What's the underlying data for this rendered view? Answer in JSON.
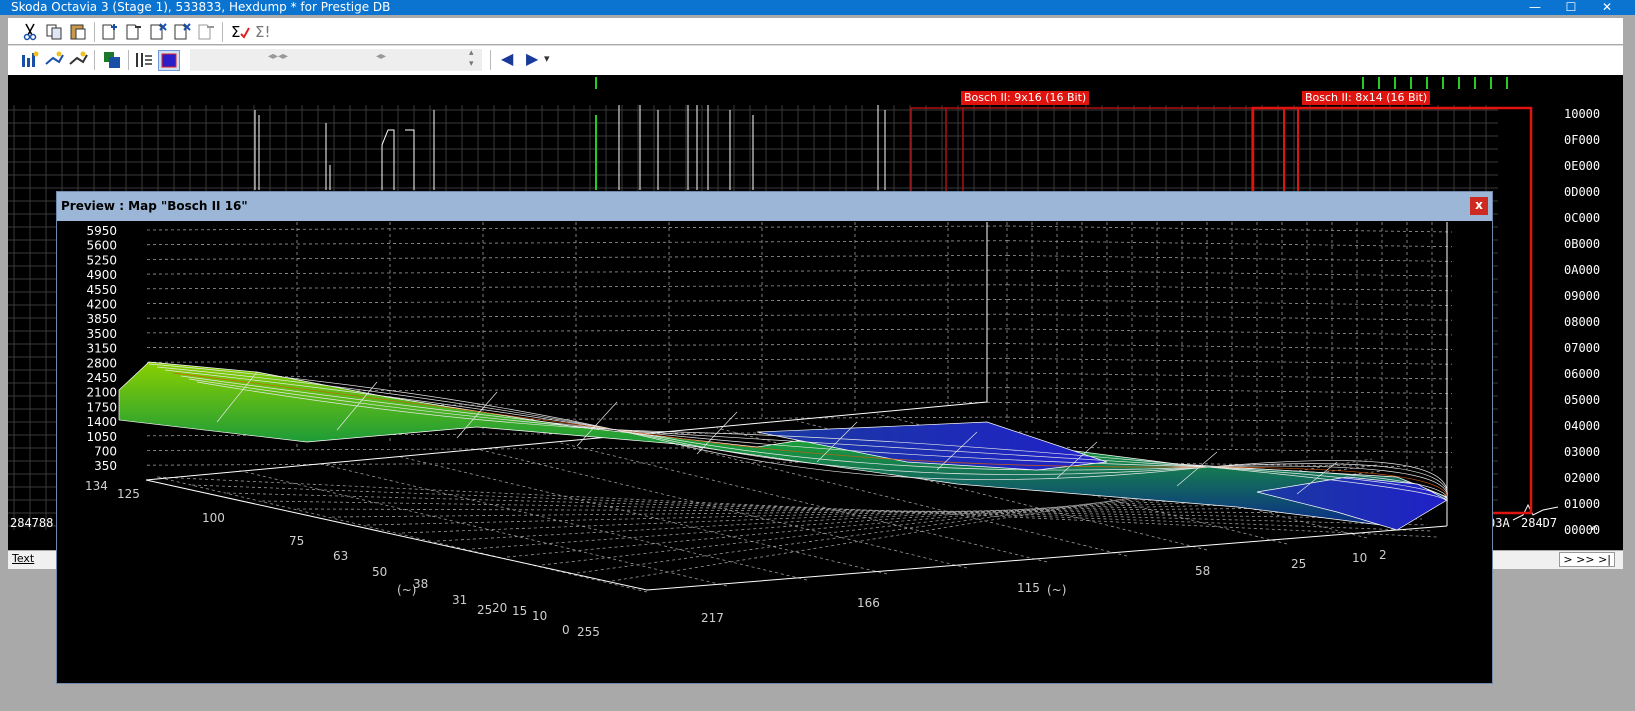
{
  "window": {
    "title": "Skoda Octavia 3 (Stage 1), 533833, Hexdump * for Prestige DB",
    "minimize": "—",
    "maximize": "☐",
    "close": "✕"
  },
  "toolbar1": {
    "icons": [
      "cut-icon",
      "copy-icon",
      "paste-icon",
      "new-map-icon",
      "remove-map-icon",
      "delete-map-icon",
      "delete-map-alt-icon",
      "export-map-icon",
      "checksum-icon",
      "checksum-all-icon"
    ]
  },
  "toolbar2": {
    "icons": [
      "map-edit-icon",
      "map-edit2-icon",
      "map-edit3-icon",
      "import-icon",
      "columns-icon",
      "color-mode-icon"
    ],
    "nav_prev": "◀",
    "nav_next": "▶",
    "nav_dropdown": "▾"
  },
  "hexview": {
    "map_labels": [
      "Bosch II: 9x16 (16 Bit)",
      "Bosch II: 8x14 (16 Bit)"
    ],
    "y_labels": [
      "10000",
      "0F000",
      "0E000",
      "0D000",
      "0C000",
      "0B000",
      "0A000",
      "09000",
      "08000",
      "07000",
      "06000",
      "05000",
      "04000",
      "03000",
      "02000",
      "01000",
      "00000"
    ],
    "bottom_addresses": {
      "left": "284788",
      "right1": "03A",
      "right2": "284D7"
    }
  },
  "bottombar": {
    "tab_label": "Text",
    "nav_label": "> >> >|"
  },
  "preview": {
    "title": "Preview : Map \"Bosch II 16\"",
    "close_label": "x",
    "z_axis_labels": [
      "5950",
      "5600",
      "5250",
      "4900",
      "4550",
      "4200",
      "3850",
      "3500",
      "3150",
      "2800",
      "2450",
      "2100",
      "1750",
      "1400",
      "1050",
      "700",
      "350"
    ],
    "y_axis_labels": [
      "134",
      "125",
      "100",
      "75",
      "63",
      "50",
      "38",
      "31",
      "25",
      "20",
      "15",
      "10",
      "0"
    ],
    "y_axis_title": "(~)",
    "x_axis_labels": [
      "255",
      "217",
      "166",
      "115",
      "58",
      "25",
      "10",
      "2"
    ],
    "x_axis_title": "(~)"
  }
}
